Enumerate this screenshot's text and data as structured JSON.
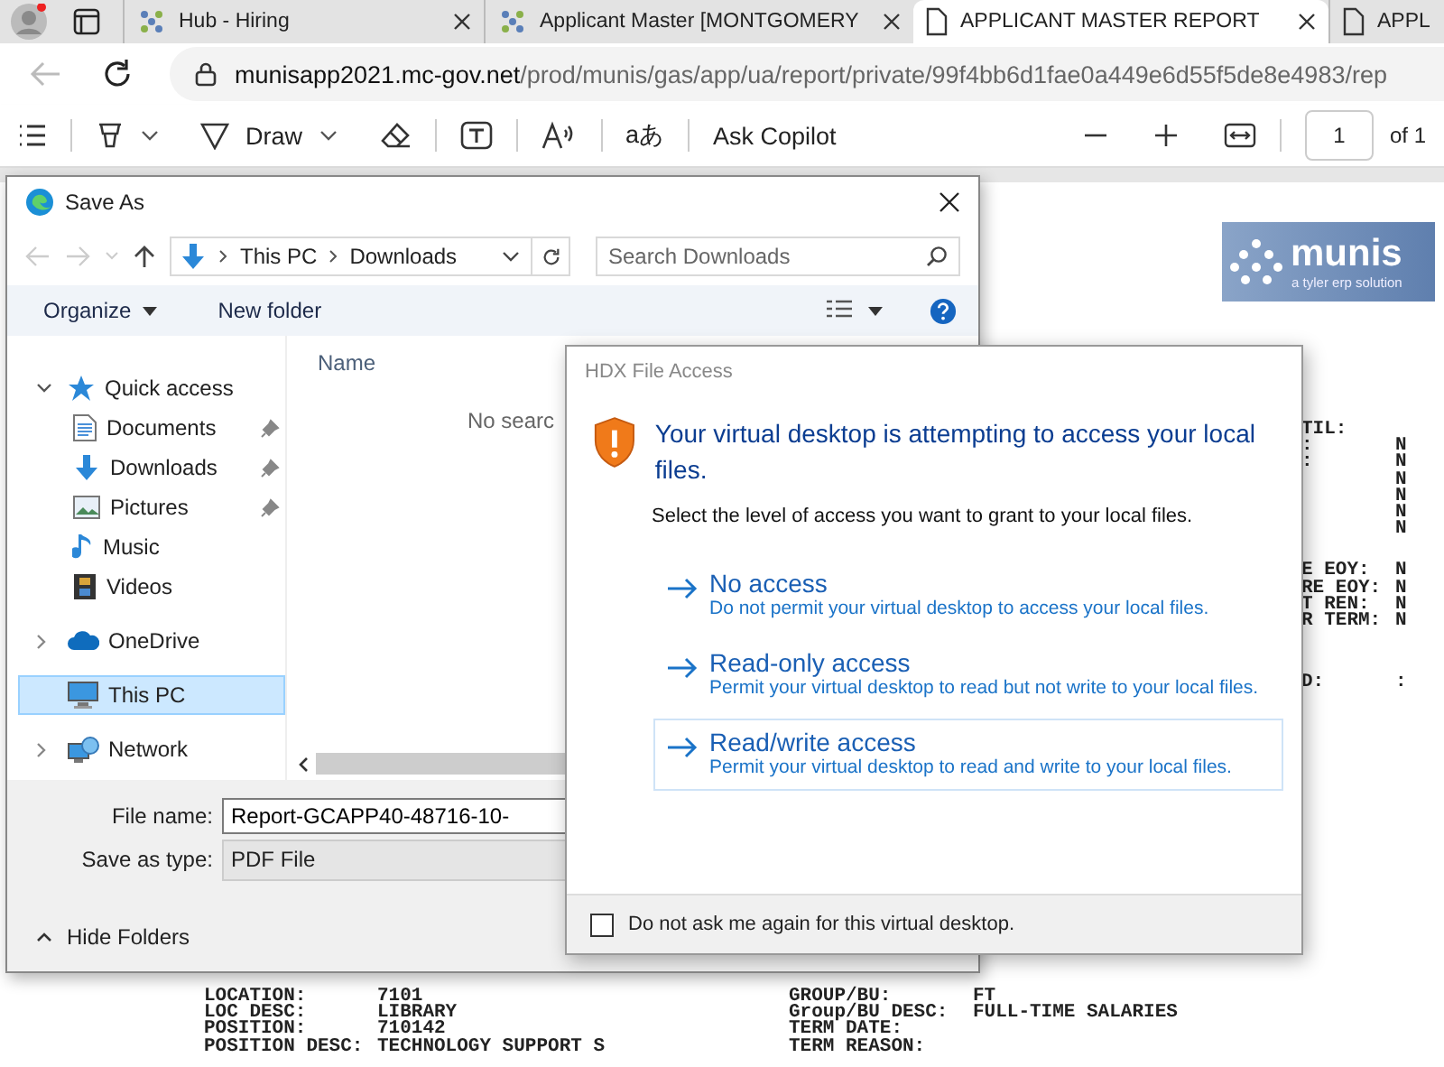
{
  "browser": {
    "tabs": [
      {
        "title": "Hub - Hiring",
        "kind": "site",
        "selected": false
      },
      {
        "title": "Applicant Master [MONTGOMERY",
        "kind": "site",
        "selected": false
      },
      {
        "title": "APPLICANT MASTER REPORT",
        "kind": "document",
        "selected": true
      },
      {
        "title": "APPL",
        "kind": "document",
        "selected": false
      }
    ],
    "address": {
      "host": "munisapp2021.mc-gov.net",
      "path": "/prod/munis/gas/app/ua/report/private/99f4bb6d1fae0a449e6d55f5de8e4983/rep"
    }
  },
  "pdf_toolbar": {
    "draw_label": "Draw",
    "translate_glyph": "aあ",
    "copilot_label": "Ask Copilot",
    "page": "1",
    "page_count": "of 1"
  },
  "report": {
    "logo": {
      "name": "munis",
      "tagline": "a tyler erp solution"
    },
    "right_column": [
      {
        "label": "TIL:"
      },
      {
        "label": ":",
        "value": "N"
      },
      {
        "label": ":",
        "value": "N"
      },
      {
        "value": "N"
      },
      {
        "value": "N"
      },
      {
        "value": "N"
      },
      {
        "value": "N"
      },
      {
        "gap": true,
        "label": "E EOY:",
        "value": "N"
      },
      {
        "label": "RE EOY:",
        "value": "N"
      },
      {
        "label": "T REN:",
        "value": "N"
      },
      {
        "label": "R TERM:",
        "value": "N"
      },
      {
        "gap": true,
        "label": "D:",
        "value": ":"
      }
    ],
    "fields": [
      {
        "label": "LOCATION:",
        "value": "7101",
        "label_2": "GROUP/BU:",
        "value_2": "FT"
      },
      {
        "label": "LOC DESC:",
        "value": "LIBRARY",
        "label_2": "Group/BU DESC:",
        "value_2": "FULL-TIME SALARIES"
      },
      {
        "label": "POSITION:",
        "value": "710142",
        "label_2": "TERM DATE:"
      },
      {
        "label": "POSITION DESC:",
        "value": "TECHNOLOGY SUPPORT S",
        "label_2": "TERM REASON:"
      }
    ]
  },
  "save_as": {
    "title": "Save As",
    "breadcrumb": [
      "This PC",
      "Downloads"
    ],
    "search_placeholder": "Search Downloads",
    "toolbar": {
      "organize": "Organize",
      "new_folder": "New folder"
    },
    "tree": [
      {
        "label": "Quick access",
        "expanded": true,
        "selected": false,
        "children": [
          {
            "label": "Documents",
            "pinned": true,
            "selected": false
          },
          {
            "label": "Downloads",
            "pinned": true,
            "selected": false
          },
          {
            "label": "Pictures",
            "pinned": true,
            "selected": false
          },
          {
            "label": "Music",
            "pinned": false,
            "selected": false
          },
          {
            "label": "Videos",
            "pinned": false,
            "selected": false
          }
        ]
      },
      {
        "label": "OneDrive",
        "expanded": false,
        "selected": false
      },
      {
        "label": "This PC",
        "selected": true
      },
      {
        "label": "Network",
        "expanded": false,
        "selected": false
      }
    ],
    "column": "Name",
    "empty_message": "No searc",
    "file_name_label": "File name:",
    "file_name": "Report-GCAPP40-48716-10-",
    "type_label": "Save as type:",
    "type": "PDF File",
    "hide_folders": "Hide Folders"
  },
  "hdx": {
    "title": "HDX File Access",
    "heading": "Your virtual desktop is attempting to access your local files.",
    "instruction": "Select the level of access you want to grant to your local files.",
    "options": [
      {
        "title": "No access",
        "description": "Do not permit your virtual desktop to access your local files.",
        "selected": false
      },
      {
        "title": "Read-only access",
        "description": "Permit your virtual desktop to read but not write to your local files.",
        "selected": false
      },
      {
        "title": "Read/write access",
        "description": "Permit your virtual desktop to read and write to your local files.",
        "selected": true
      }
    ],
    "checkbox": {
      "label": "Do not ask me again for this virtual desktop.",
      "checked": false
    }
  }
}
